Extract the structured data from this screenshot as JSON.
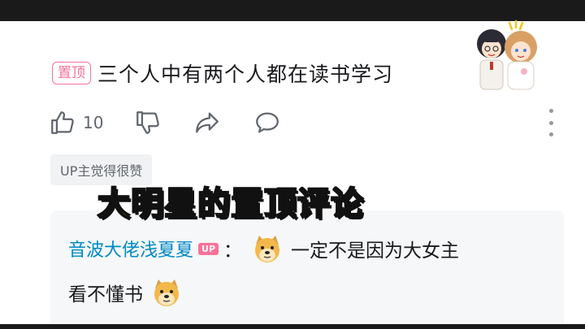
{
  "comment": {
    "pin_label": "置顶",
    "text": "三个人中有两个人都在读书学习"
  },
  "actions": {
    "like_count": "10"
  },
  "up_liked_label": "UP主觉得很赞",
  "caption": "大明星的置顶评论",
  "reply": {
    "username": "音波大佬浅夏夏",
    "up_tag": "UP",
    "colon": "：",
    "text_line1": "一定不是因为大女主",
    "text_line2": "看不懂书"
  },
  "colors": {
    "pink": "#fb7299",
    "link_blue": "#008ac5",
    "caption_yellow": "#ffd400"
  },
  "icons": [
    "thumbs-up-icon",
    "thumbs-down-icon",
    "share-icon",
    "reply-bubble-icon",
    "more-icon",
    "doge-emoji-icon"
  ]
}
